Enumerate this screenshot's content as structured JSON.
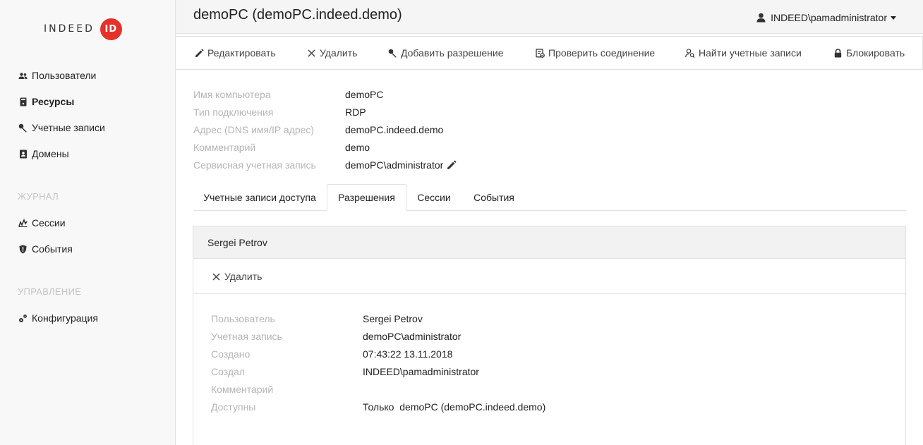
{
  "logo": {
    "text": "INDEED",
    "badge": "ID"
  },
  "sidebar": {
    "items": [
      {
        "label": "Пользователи",
        "icon": "users-icon"
      },
      {
        "label": "Ресурсы",
        "icon": "server-icon"
      },
      {
        "label": "Учетные записи",
        "icon": "key-icon"
      },
      {
        "label": "Домены",
        "icon": "address-book-icon"
      }
    ],
    "journal_title": "ЖУРНАЛ",
    "journal_items": [
      {
        "label": "Сессии",
        "icon": "sessions-icon"
      },
      {
        "label": "События",
        "icon": "shield-icon"
      }
    ],
    "manage_title": "УПРАВЛЕНИЕ",
    "manage_items": [
      {
        "label": "Конфигурация",
        "icon": "cogs-icon"
      }
    ]
  },
  "header": {
    "title": "demoPC (demoPC.indeed.demo)",
    "user": "INDEED\\pamadministrator"
  },
  "toolbar": {
    "edit": "Редактировать",
    "delete": "Удалить",
    "add_permission": "Добавить разрешение",
    "check_connection": "Проверить соединение",
    "find_accounts": "Найти учетные записи",
    "block": "Блокировать"
  },
  "properties": {
    "computer_name_label": "Имя компьютера",
    "computer_name": "demoPC",
    "connection_type_label": "Тип подключения",
    "connection_type": "RDP",
    "address_label": "Адрес (DNS имя/IP адрес)",
    "address": "demoPC.indeed.demo",
    "comment_label": "Комментарий",
    "comment": "demo",
    "service_account_label": "Сервисная учетная запись",
    "service_account": "demoPC\\administrator"
  },
  "tabs": [
    {
      "label": "Учетные записи доступа"
    },
    {
      "label": "Разрешения"
    },
    {
      "label": "Сессии"
    },
    {
      "label": "События"
    }
  ],
  "permission": {
    "title": "Sergei Petrov",
    "delete": "Удалить",
    "user_label": "Пользователь",
    "user": "Sergei Petrov",
    "account_label": "Учетная запись",
    "account": "demoPC\\administrator",
    "created_label": "Создано",
    "created": "07:43:22 13.11.2018",
    "creator_label": "Создал",
    "creator": "INDEED\\pamadministrator",
    "comment_label": "Комментарий",
    "comment": "",
    "available_label": "Доступны",
    "available": "Только  demoPC (demoPC.indeed.demo)"
  }
}
